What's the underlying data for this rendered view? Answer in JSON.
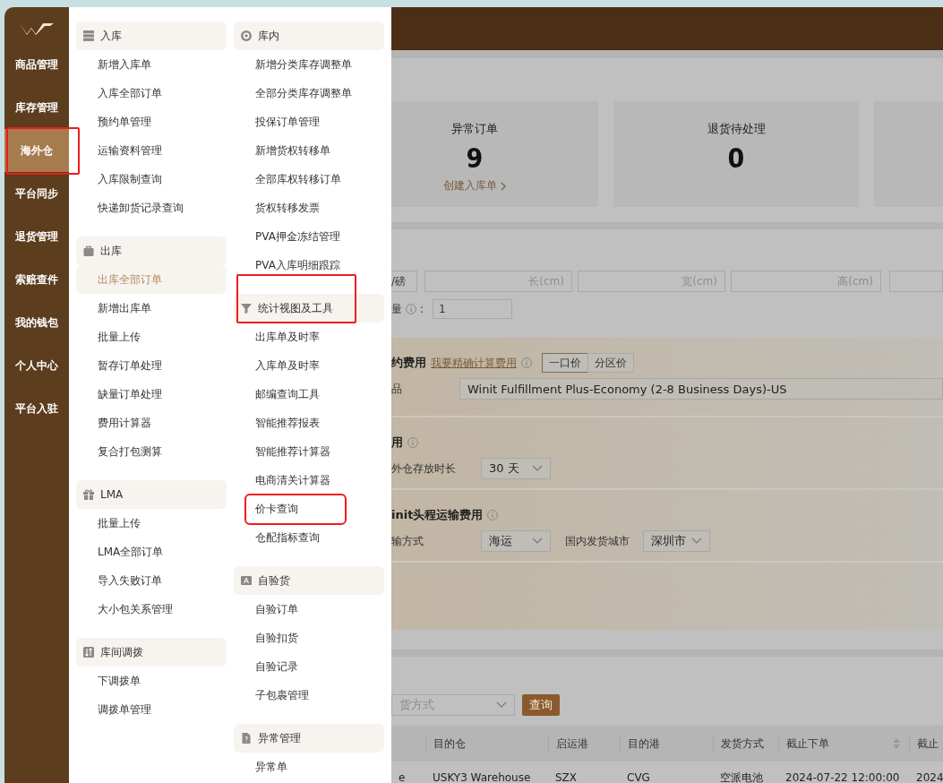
{
  "sidebar": {
    "items": [
      {
        "label": "商品管理",
        "selected": false,
        "highlighted": false
      },
      {
        "label": "库存管理",
        "selected": false,
        "highlighted": false
      },
      {
        "label": "海外仓",
        "selected": true,
        "highlighted": true
      },
      {
        "label": "平台同步",
        "selected": false,
        "highlighted": false
      },
      {
        "label": "退货管理",
        "selected": false,
        "highlighted": false
      },
      {
        "label": "索赔查件",
        "selected": false,
        "highlighted": false
      },
      {
        "label": "我的钱包",
        "selected": false,
        "highlighted": false
      },
      {
        "label": "个人中心",
        "selected": false,
        "highlighted": false
      },
      {
        "label": "平台入驻",
        "selected": false,
        "highlighted": false
      }
    ]
  },
  "menu": {
    "columns": [
      {
        "groups": [
          {
            "title": "入库",
            "highlighted": false,
            "items": [
              {
                "label": "新增入库单",
                "selected": false,
                "highlighted": false
              },
              {
                "label": "入库全部订单",
                "selected": false,
                "highlighted": false
              },
              {
                "label": "预约单管理",
                "selected": false,
                "highlighted": false
              },
              {
                "label": "运输资料管理",
                "selected": false,
                "highlighted": false
              },
              {
                "label": "入库限制查询",
                "selected": false,
                "highlighted": false
              },
              {
                "label": "快递卸货记录查询",
                "selected": false,
                "highlighted": false
              }
            ]
          },
          {
            "title": "出库",
            "highlighted": false,
            "items": [
              {
                "label": "出库全部订单",
                "selected": true,
                "highlighted": false
              },
              {
                "label": "新增出库单",
                "selected": false,
                "highlighted": false
              },
              {
                "label": "批量上传",
                "selected": false,
                "highlighted": false
              },
              {
                "label": "暂存订单处理",
                "selected": false,
                "highlighted": false
              },
              {
                "label": "缺量订单处理",
                "selected": false,
                "highlighted": false
              },
              {
                "label": "费用计算器",
                "selected": false,
                "highlighted": false
              },
              {
                "label": "复合打包测算",
                "selected": false,
                "highlighted": false
              }
            ]
          },
          {
            "title": "LMA",
            "highlighted": false,
            "items": [
              {
                "label": "批量上传",
                "selected": false,
                "highlighted": false
              },
              {
                "label": "LMA全部订单",
                "selected": false,
                "highlighted": false
              },
              {
                "label": "导入失败订单",
                "selected": false,
                "highlighted": false
              },
              {
                "label": "大小包关系管理",
                "selected": false,
                "highlighted": false
              }
            ]
          },
          {
            "title": "库间调拨",
            "highlighted": false,
            "items": [
              {
                "label": "下调拨单",
                "selected": false,
                "highlighted": false
              },
              {
                "label": "调拨单管理",
                "selected": false,
                "highlighted": false
              }
            ]
          }
        ]
      },
      {
        "groups": [
          {
            "title": "库内",
            "highlighted": false,
            "items": [
              {
                "label": "新增分类库存调整单",
                "selected": false,
                "highlighted": false
              },
              {
                "label": "全部分类库存调整单",
                "selected": false,
                "highlighted": false
              },
              {
                "label": "投保订单管理",
                "selected": false,
                "highlighted": false
              },
              {
                "label": "新增货权转移单",
                "selected": false,
                "highlighted": false
              },
              {
                "label": "全部库权转移订单",
                "selected": false,
                "highlighted": false
              },
              {
                "label": "货权转移发票",
                "selected": false,
                "highlighted": false
              },
              {
                "label": "PVA押金冻结管理",
                "selected": false,
                "highlighted": false
              },
              {
                "label": "PVA入库明细跟踪",
                "selected": false,
                "highlighted": false
              }
            ]
          },
          {
            "title": "统计视图及工具",
            "highlighted": true,
            "items": [
              {
                "label": "出库单及时率",
                "selected": false,
                "highlighted": false
              },
              {
                "label": "入库单及时率",
                "selected": false,
                "highlighted": false
              },
              {
                "label": "邮编查询工具",
                "selected": false,
                "highlighted": false
              },
              {
                "label": "智能推荐报表",
                "selected": false,
                "highlighted": false
              },
              {
                "label": "智能推荐计算器",
                "selected": false,
                "highlighted": false
              },
              {
                "label": "电商清关计算器",
                "selected": false,
                "highlighted": false
              },
              {
                "label": "价卡查询",
                "selected": false,
                "highlighted": true
              },
              {
                "label": "仓配指标查询",
                "selected": false,
                "highlighted": false
              }
            ]
          },
          {
            "title": "自验货",
            "highlighted": false,
            "items": [
              {
                "label": "自验订单",
                "selected": false,
                "highlighted": false
              },
              {
                "label": "自验扣货",
                "selected": false,
                "highlighted": false
              },
              {
                "label": "自验记录",
                "selected": false,
                "highlighted": false
              },
              {
                "label": "子包裹管理",
                "selected": false,
                "highlighted": false
              }
            ]
          },
          {
            "title": "异常管理",
            "highlighted": false,
            "items": [
              {
                "label": "异常单",
                "selected": false,
                "highlighted": false
              }
            ]
          }
        ]
      }
    ]
  },
  "stats": [
    {
      "title": "异常订单",
      "value": "9",
      "link": "创建入库单"
    },
    {
      "title": "退货待处理",
      "value": "0"
    }
  ],
  "dimensions": {
    "unit": "/磅",
    "fields": [
      {
        "placeholder": "长(cm)"
      },
      {
        "placeholder": "宽(cm)"
      },
      {
        "placeholder": "高(cm)"
      }
    ]
  },
  "quantity": {
    "label": "量",
    "colon": ":",
    "value": "1"
  },
  "fulfillment": {
    "title": "约费用",
    "link": "我要精确计算费用",
    "pricing": [
      {
        "label": "一口价",
        "selected": true
      },
      {
        "label": "分区价",
        "selected": false
      }
    ],
    "product_label": "品",
    "product": "Winit Fulfillment Plus-Economy (2-8 Business Days)-US"
  },
  "storage": {
    "title": "用",
    "duration_label": "外仓存放时长",
    "duration": "30 天"
  },
  "freight": {
    "title": "init头程运输费用",
    "method_label": "输方式",
    "method": "海运",
    "city_label": "国内发货城市",
    "city": "深圳市"
  },
  "filter": {
    "placeholder": "货方式",
    "button": "查询"
  },
  "table": {
    "columns": [
      "",
      "目的仓",
      "启运港",
      "目的港",
      "发货方式",
      "截止下单",
      "截止"
    ],
    "rows": [
      [
        "e",
        "USKY3 Warehouse",
        "SZX",
        "CVG",
        "空派电池",
        "2024-07-22 12:00:00",
        "2024"
      ]
    ]
  }
}
